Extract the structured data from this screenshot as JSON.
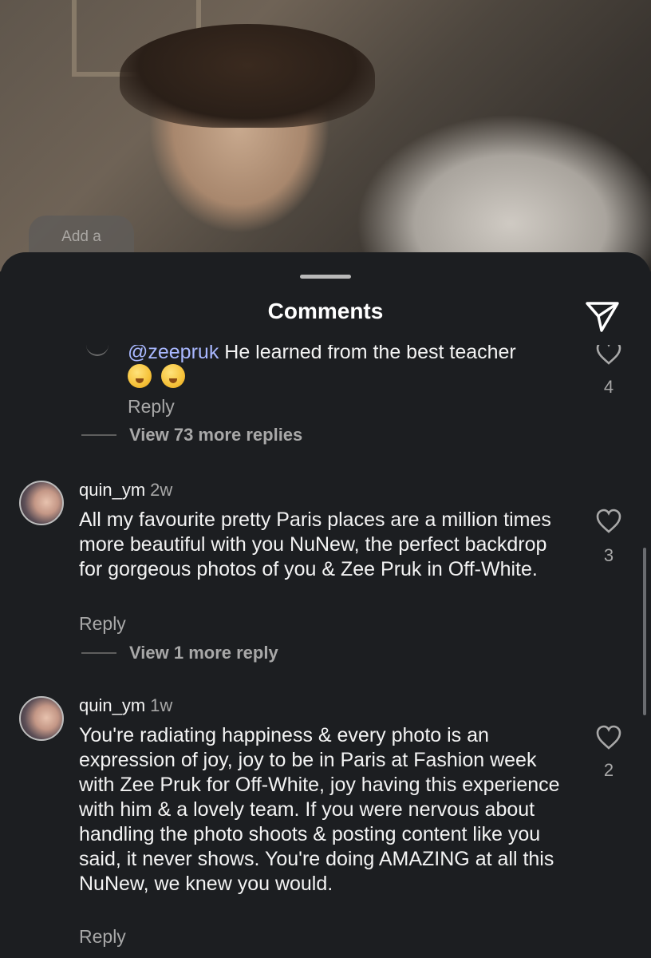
{
  "background": {
    "add_thought_label": "Add a"
  },
  "sheet": {
    "title": "Comments"
  },
  "comments": [
    {
      "mention": "@zeepruk",
      "text": "He learned from the best teacher",
      "emojis": [
        "face-with-hand-over-mouth",
        "kissing-face"
      ],
      "reply_label": "Reply",
      "likes": "4",
      "view_more": "View 73 more replies"
    },
    {
      "author": "quin_ym",
      "time": "2w",
      "text": "All my favourite pretty Paris places are a million times more beautiful with you NuNew, the perfect backdrop for gorgeous photos of you & Zee Pruk in Off-White.",
      "reply_label": "Reply",
      "likes": "3",
      "view_more": "View 1 more reply"
    },
    {
      "author": "quin_ym",
      "time": "1w",
      "text": "You're radiating happiness & every photo is an expression of joy, joy to be in Paris at Fashion week with Zee Pruk for Off-White, joy having this experience with him & a lovely team. If you were nervous about handling the photo shoots & posting content like you said, it never shows. You're doing AMAZING at all this NuNew, we knew you would.",
      "reply_label": "Reply",
      "likes": "2"
    }
  ],
  "icons": {
    "share": "paper-plane-icon",
    "like": "heart-icon"
  },
  "colors": {
    "sheet_bg": "#1c1e21",
    "mention": "#a9b8ff",
    "secondary_text": "#a8a8a8"
  }
}
